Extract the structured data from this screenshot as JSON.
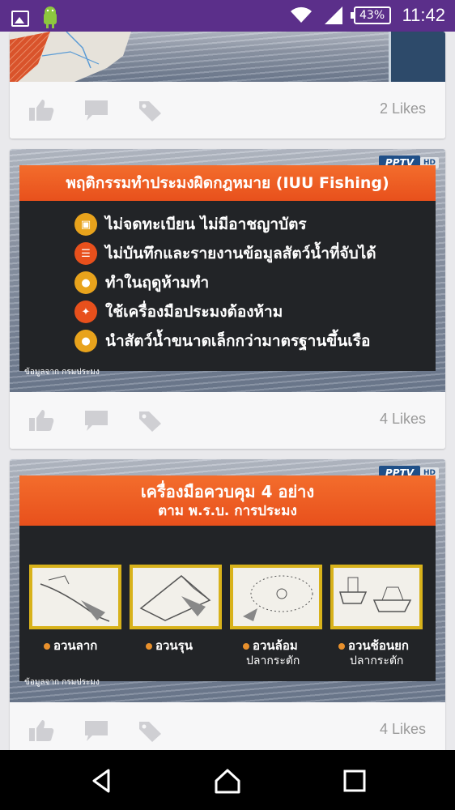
{
  "status_bar": {
    "battery": "43%",
    "time": "11:42"
  },
  "cards": [
    {
      "likes": "2 Likes"
    },
    {
      "badge": "PPTV",
      "badge_hd": "HD",
      "title": "พฤติกรรมทำประมงผิดกฎหมาย (IUU Fishing)",
      "items": [
        "ไม่จดทะเบียน ไม่มีอาชญาบัตร",
        "ไม่บันทึกและรายงานข้อมูลสัตว์น้ำที่จับได้",
        "ทำในฤดูห้ามทำ",
        "ใช้เครื่องมือประมงต้องห้าม",
        "นำสัตว์น้ำขนาดเล็กกว่ามาตรฐานขึ้นเรือ"
      ],
      "credit": "ข้อมูลจาก กรมประมง",
      "likes": "4 Likes"
    },
    {
      "badge": "PPTV",
      "badge_hd": "HD",
      "title_line1": "เครื่องมือควบคุม 4 อย่าง",
      "title_line2": "ตาม พ.ร.บ. การประมง",
      "gears": [
        {
          "name": "อวนลาก",
          "sub": ""
        },
        {
          "name": "อวนรุน",
          "sub": ""
        },
        {
          "name": "อวนล้อม",
          "sub": "ปลากระตัก"
        },
        {
          "name": "อวนช้อนยก",
          "sub": "ปลากระตัก"
        }
      ],
      "credit": "ข้อมูลจาก กรมประมง",
      "likes": "4 Likes"
    }
  ],
  "colors": {
    "status_bar": "#5b2f8a",
    "slide_title": "#e8501c",
    "frame": "#d8b21b"
  }
}
